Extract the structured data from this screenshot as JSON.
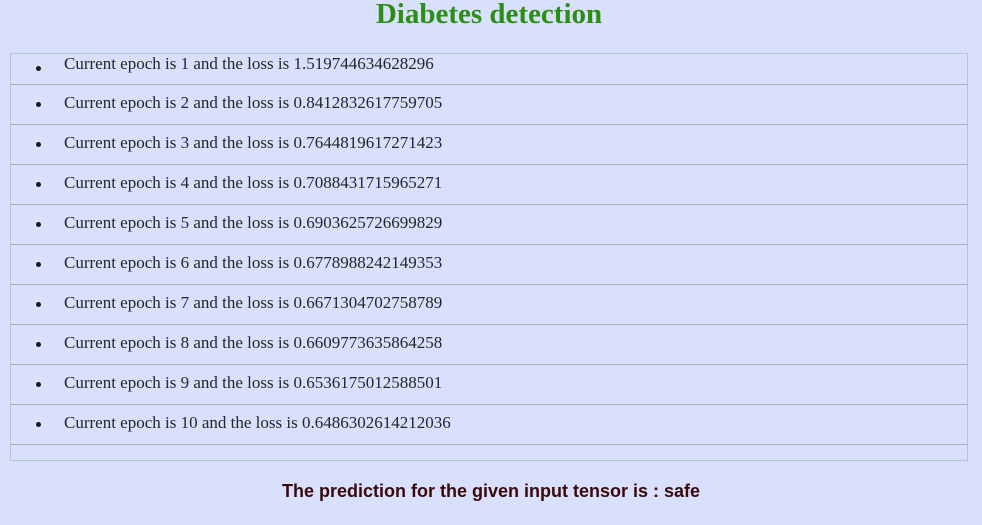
{
  "header": {
    "title": "Diabetes detection"
  },
  "epochs": [
    {
      "text": "Current epoch is 1 and the loss is 1.519744634628296"
    },
    {
      "text": "Current epoch is 2 and the loss is 0.8412832617759705"
    },
    {
      "text": "Current epoch is 3 and the loss is 0.7644819617271423"
    },
    {
      "text": "Current epoch is 4 and the loss is 0.7088431715965271"
    },
    {
      "text": "Current epoch is 5 and the loss is 0.6903625726699829"
    },
    {
      "text": "Current epoch is 6 and the loss is 0.6778988242149353"
    },
    {
      "text": "Current epoch is 7 and the loss is 0.6671304702758789"
    },
    {
      "text": "Current epoch is 8 and the loss is 0.6609773635864258"
    },
    {
      "text": "Current epoch is 9 and the loss is 0.6536175012588501"
    },
    {
      "text": "Current epoch is 10 and the loss is 0.6486302614212036"
    }
  ],
  "result": {
    "prediction_text": "The prediction for the given input tensor is : safe"
  },
  "colors": {
    "background": "#d9e0fd",
    "title": "#2a8f12",
    "prediction": "#3a0808"
  }
}
